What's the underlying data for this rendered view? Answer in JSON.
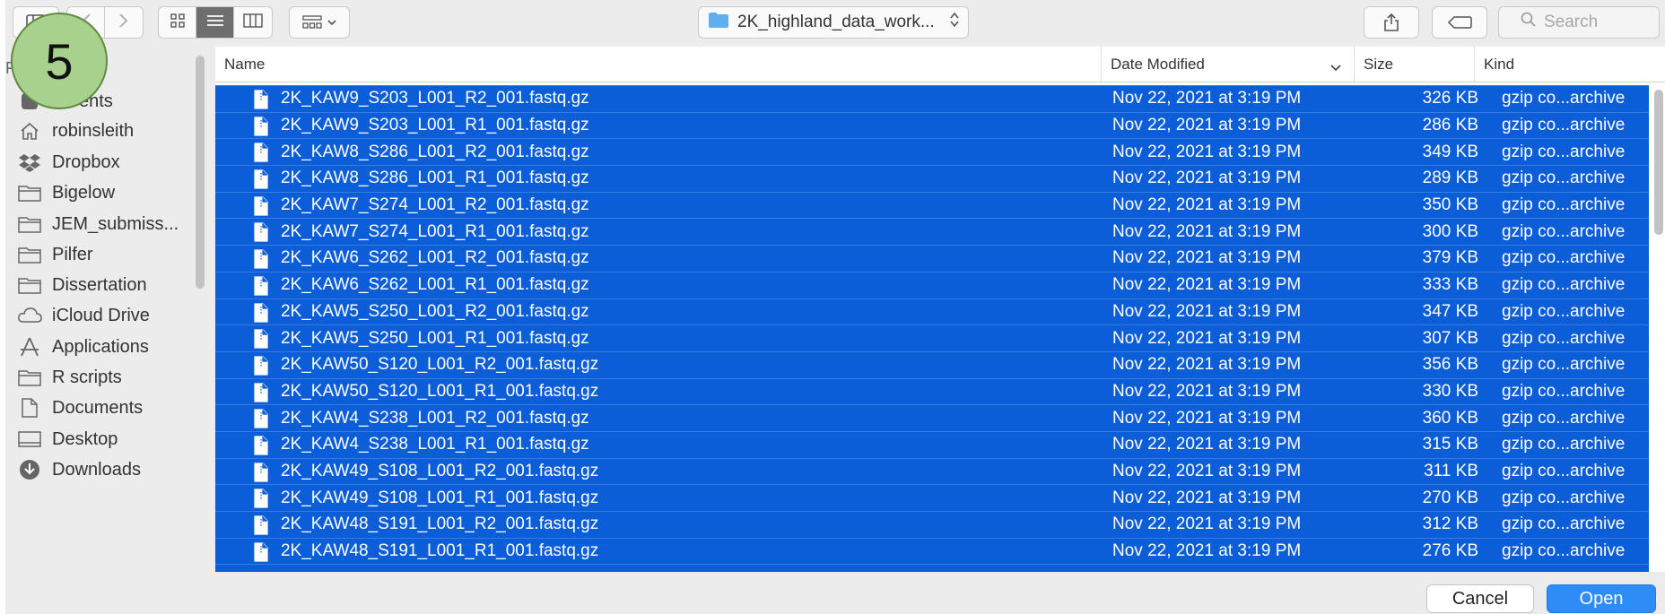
{
  "step_badge": "5",
  "toolbar": {
    "path_label": "2K_highland_data_work...",
    "search_placeholder": "Search",
    "view_modes": [
      "icon-view",
      "list-view",
      "column-view"
    ],
    "active_view": "list-view"
  },
  "sidebar": {
    "partial_section_label": "F",
    "items": [
      {
        "label": "Recents",
        "icon": "recents-icon"
      },
      {
        "label": "robinsleith",
        "icon": "home-icon"
      },
      {
        "label": "Dropbox",
        "icon": "dropbox-icon"
      },
      {
        "label": "Bigelow",
        "icon": "folder-icon"
      },
      {
        "label": "JEM_submiss...",
        "icon": "folder-icon"
      },
      {
        "label": "Pilfer",
        "icon": "folder-icon"
      },
      {
        "label": "Dissertation",
        "icon": "folder-icon"
      },
      {
        "label": "iCloud Drive",
        "icon": "cloud-icon"
      },
      {
        "label": "Applications",
        "icon": "applications-icon"
      },
      {
        "label": "R scripts",
        "icon": "folder-icon"
      },
      {
        "label": "Documents",
        "icon": "documents-icon"
      },
      {
        "label": "Desktop",
        "icon": "desktop-icon"
      },
      {
        "label": "Downloads",
        "icon": "downloads-icon"
      }
    ],
    "recents_visible_text": "ents"
  },
  "list": {
    "columns": [
      "Name",
      "Date Modified",
      "Size",
      "Kind"
    ],
    "sort_column": "Date Modified",
    "selection_color": "#0b5ed7",
    "rows": [
      {
        "name": "2K_KAW9_S203_L001_R2_001.fastq.gz",
        "date": "Nov 22, 2021 at 3:19 PM",
        "size": "326 KB",
        "kind": "gzip co...archive"
      },
      {
        "name": "2K_KAW9_S203_L001_R1_001.fastq.gz",
        "date": "Nov 22, 2021 at 3:19 PM",
        "size": "286 KB",
        "kind": "gzip co...archive"
      },
      {
        "name": "2K_KAW8_S286_L001_R2_001.fastq.gz",
        "date": "Nov 22, 2021 at 3:19 PM",
        "size": "349 KB",
        "kind": "gzip co...archive"
      },
      {
        "name": "2K_KAW8_S286_L001_R1_001.fastq.gz",
        "date": "Nov 22, 2021 at 3:19 PM",
        "size": "289 KB",
        "kind": "gzip co...archive"
      },
      {
        "name": "2K_KAW7_S274_L001_R2_001.fastq.gz",
        "date": "Nov 22, 2021 at 3:19 PM",
        "size": "350 KB",
        "kind": "gzip co...archive"
      },
      {
        "name": "2K_KAW7_S274_L001_R1_001.fastq.gz",
        "date": "Nov 22, 2021 at 3:19 PM",
        "size": "300 KB",
        "kind": "gzip co...archive"
      },
      {
        "name": "2K_KAW6_S262_L001_R2_001.fastq.gz",
        "date": "Nov 22, 2021 at 3:19 PM",
        "size": "379 KB",
        "kind": "gzip co...archive"
      },
      {
        "name": "2K_KAW6_S262_L001_R1_001.fastq.gz",
        "date": "Nov 22, 2021 at 3:19 PM",
        "size": "333 KB",
        "kind": "gzip co...archive"
      },
      {
        "name": "2K_KAW5_S250_L001_R2_001.fastq.gz",
        "date": "Nov 22, 2021 at 3:19 PM",
        "size": "347 KB",
        "kind": "gzip co...archive"
      },
      {
        "name": "2K_KAW5_S250_L001_R1_001.fastq.gz",
        "date": "Nov 22, 2021 at 3:19 PM",
        "size": "307 KB",
        "kind": "gzip co...archive"
      },
      {
        "name": "2K_KAW50_S120_L001_R2_001.fastq.gz",
        "date": "Nov 22, 2021 at 3:19 PM",
        "size": "356 KB",
        "kind": "gzip co...archive"
      },
      {
        "name": "2K_KAW50_S120_L001_R1_001.fastq.gz",
        "date": "Nov 22, 2021 at 3:19 PM",
        "size": "330 KB",
        "kind": "gzip co...archive"
      },
      {
        "name": "2K_KAW4_S238_L001_R2_001.fastq.gz",
        "date": "Nov 22, 2021 at 3:19 PM",
        "size": "360 KB",
        "kind": "gzip co...archive"
      },
      {
        "name": "2K_KAW4_S238_L001_R1_001.fastq.gz",
        "date": "Nov 22, 2021 at 3:19 PM",
        "size": "315 KB",
        "kind": "gzip co...archive"
      },
      {
        "name": "2K_KAW49_S108_L001_R2_001.fastq.gz",
        "date": "Nov 22, 2021 at 3:19 PM",
        "size": "311 KB",
        "kind": "gzip co...archive"
      },
      {
        "name": "2K_KAW49_S108_L001_R1_001.fastq.gz",
        "date": "Nov 22, 2021 at 3:19 PM",
        "size": "270 KB",
        "kind": "gzip co...archive"
      },
      {
        "name": "2K_KAW48_S191_L001_R2_001.fastq.gz",
        "date": "Nov 22, 2021 at 3:19 PM",
        "size": "312 KB",
        "kind": "gzip co...archive"
      },
      {
        "name": "2K_KAW48_S191_L001_R1_001.fastq.gz",
        "date": "Nov 22, 2021 at 3:19 PM",
        "size": "276 KB",
        "kind": "gzip co...archive"
      }
    ]
  },
  "footer": {
    "cancel_label": "Cancel",
    "open_label": "Open",
    "open_color": "#2d8cf6"
  }
}
